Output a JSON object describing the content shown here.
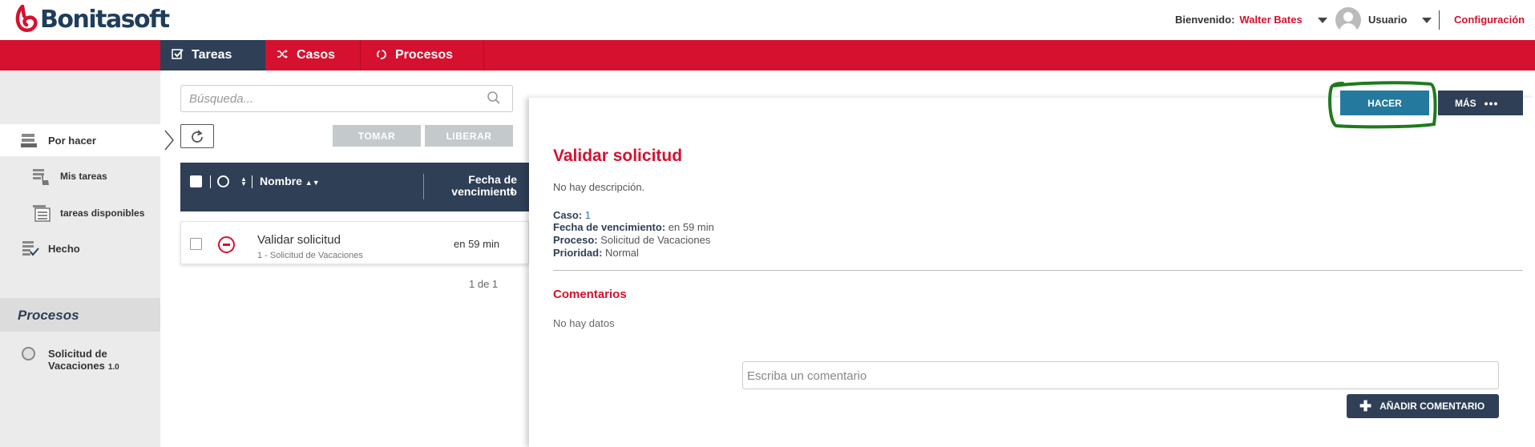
{
  "header": {
    "brand": "Bonitasoft",
    "welcome_label": "Bienvenido:",
    "user_name": "Walter Bates",
    "user_menu_label": "Usuario",
    "config_label": "Configuración"
  },
  "nav": {
    "tabs": [
      {
        "label": "Tareas",
        "icon": "tasks-check-icon",
        "active": true
      },
      {
        "label": "Casos",
        "icon": "shuffle-icon",
        "active": false
      },
      {
        "label": "Procesos",
        "icon": "process-spinner-icon",
        "active": false
      }
    ]
  },
  "sidebar": {
    "items": [
      {
        "label": "Por hacer",
        "icon": "inbox-stack-icon",
        "active": true
      },
      {
        "label": "Mis tareas",
        "icon": "my-tasks-hand-icon"
      },
      {
        "label": "tareas disponibles",
        "icon": "available-tasks-list-icon"
      },
      {
        "label": "Hecho",
        "icon": "done-list-icon"
      }
    ],
    "processes_header": "Procesos",
    "process": {
      "name": "Solicitud de Vacaciones",
      "version": "1.0"
    }
  },
  "tasklist": {
    "search_placeholder": "Búsqueda...",
    "take_label": "TOMAR",
    "release_label": "LIBERAR",
    "col_name": "Nombre",
    "col_due": "Fecha de vencimiento",
    "rows": [
      {
        "name": "Validar solicitud",
        "subtitle": "1 - Solicitud de Vacaciones",
        "due": "en 59 min",
        "priority": "normal"
      }
    ],
    "pager": "1 de 1"
  },
  "detail": {
    "do_label": "HACER",
    "more_label": "MÁS",
    "title": "Validar solicitud",
    "description": "No hay descripción.",
    "case_label": "Caso:",
    "case_value": "1",
    "due_label": "Fecha de vencimiento:",
    "due_value": "en 59 min",
    "process_label": "Proceso:",
    "process_value": "Solicitud de Vacaciones",
    "priority_label": "Prioridad:",
    "priority_value": "Normal",
    "comments_title": "Comentarios",
    "no_data": "No hay datos",
    "comment_placeholder": "Escriba un comentario",
    "add_comment_label": "AÑADIR COMENTARIO"
  },
  "colors": {
    "brand_red": "#d5112f",
    "navy": "#2e3f56",
    "do_button_blue": "#24799f",
    "annotation_green": "#1e7a1e"
  }
}
